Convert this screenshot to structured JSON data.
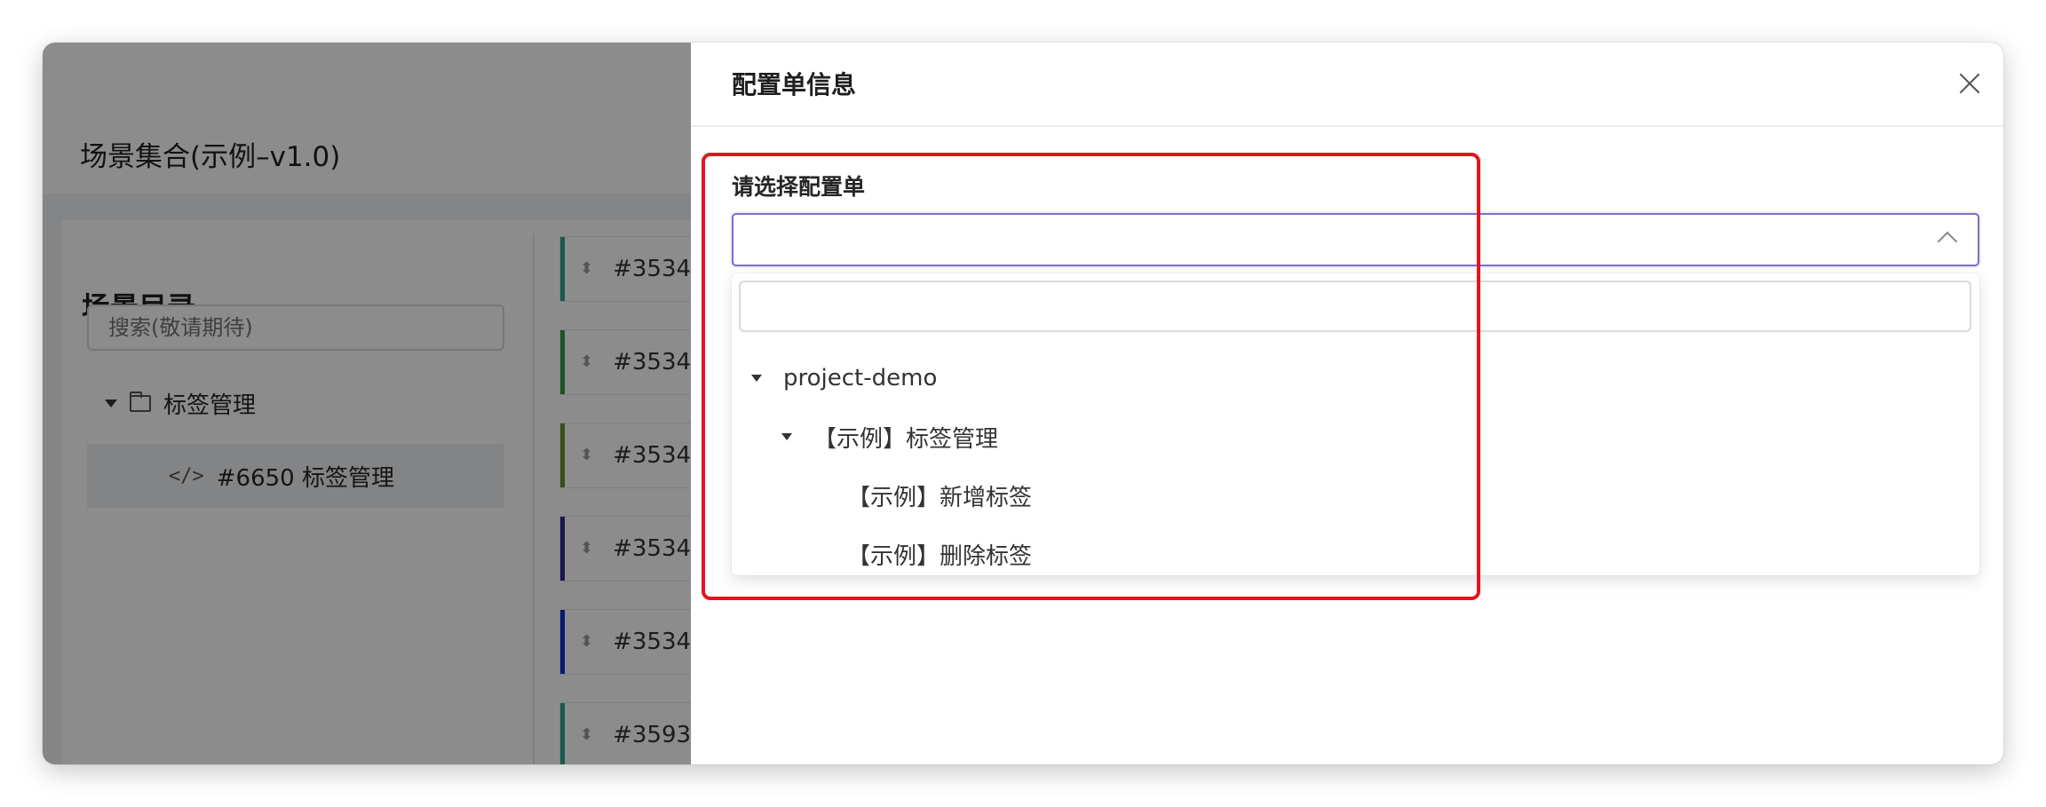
{
  "background": {
    "page_title": "场景集合(示例–v1.0)",
    "directory": {
      "title": "场景目录",
      "search_placeholder": "搜索(敬请期待)",
      "root_label": "标签管理",
      "leaf_label": "#6650 标签管理",
      "leaf_icon": "code-icon"
    },
    "cases": [
      {
        "label": "#3534",
        "color": "#2aa58f"
      },
      {
        "label": "#3534",
        "color": "#2e9b4f"
      },
      {
        "label": "#3534",
        "color": "#6d8f2a"
      },
      {
        "label": "#3534",
        "color": "#2e2a8a"
      },
      {
        "label": "#3534",
        "color": "#1030c8"
      },
      {
        "label": "#3593",
        "color": "#2aa58f"
      }
    ]
  },
  "drawer": {
    "title": "配置单信息",
    "close_icon": "close-icon",
    "field_label": "请选择配置单",
    "select_value": "",
    "dropdown": {
      "search_value": "",
      "tree": [
        {
          "label": "project-demo",
          "expanded": true,
          "level": 0
        },
        {
          "label": "【示例】标签管理",
          "expanded": true,
          "level": 1
        },
        {
          "label": "【示例】新增标签",
          "level": 2
        },
        {
          "label": "【示例】删除标签",
          "level": 2
        }
      ]
    }
  },
  "annotation": {
    "color": "#e3141f"
  }
}
